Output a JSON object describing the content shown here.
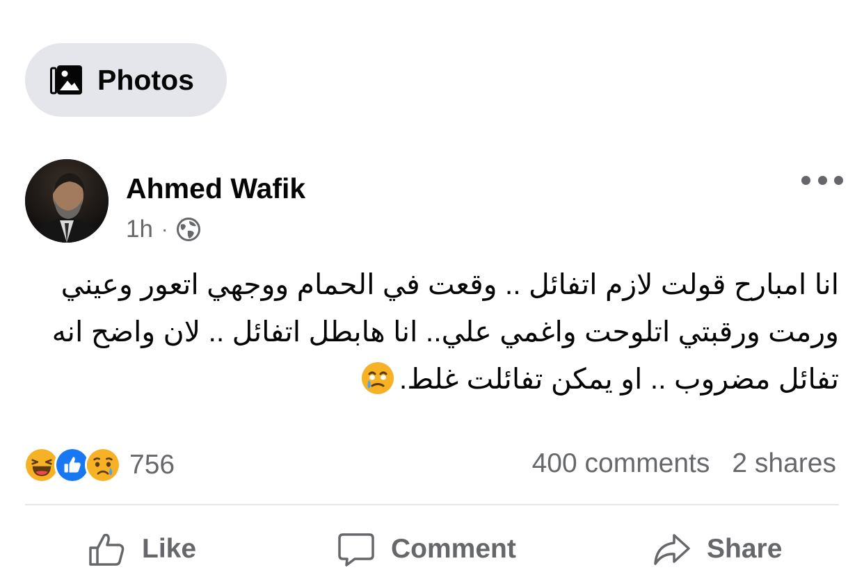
{
  "filter_chip": {
    "label": "Photos",
    "icon": "photo-album-icon"
  },
  "post": {
    "author": "Ahmed Wafik",
    "time": "1h",
    "separator": "·",
    "audience_icon": "globe-icon",
    "more_icon": "more-options-icon",
    "text": "انا امبارح قولت لازم اتفائل .. وقعت في الحمام ووجهي اتعور وعيني ورمت ورقبتي اتلوحت واغمي علي.. انا هابطل اتفائل .. لان واضح انه تفائل مضروب .. او يمكن تفائلت غلط.",
    "text_emoji": "face-holding-back-tears-emoji"
  },
  "engagement": {
    "reaction_icons": [
      "haha-reaction-icon",
      "like-reaction-icon",
      "sad-reaction-icon"
    ],
    "reaction_count": "756",
    "comments": "400 comments",
    "shares": "2 shares"
  },
  "actions": {
    "like_label": "Like",
    "comment_label": "Comment",
    "share_label": "Share"
  },
  "colors": {
    "chip_bg": "#e4e6eb",
    "secondary_text": "#65676b",
    "primary_text": "#050505",
    "like_blue": "#1877f2",
    "emoji_yellow": "#f7b125"
  }
}
